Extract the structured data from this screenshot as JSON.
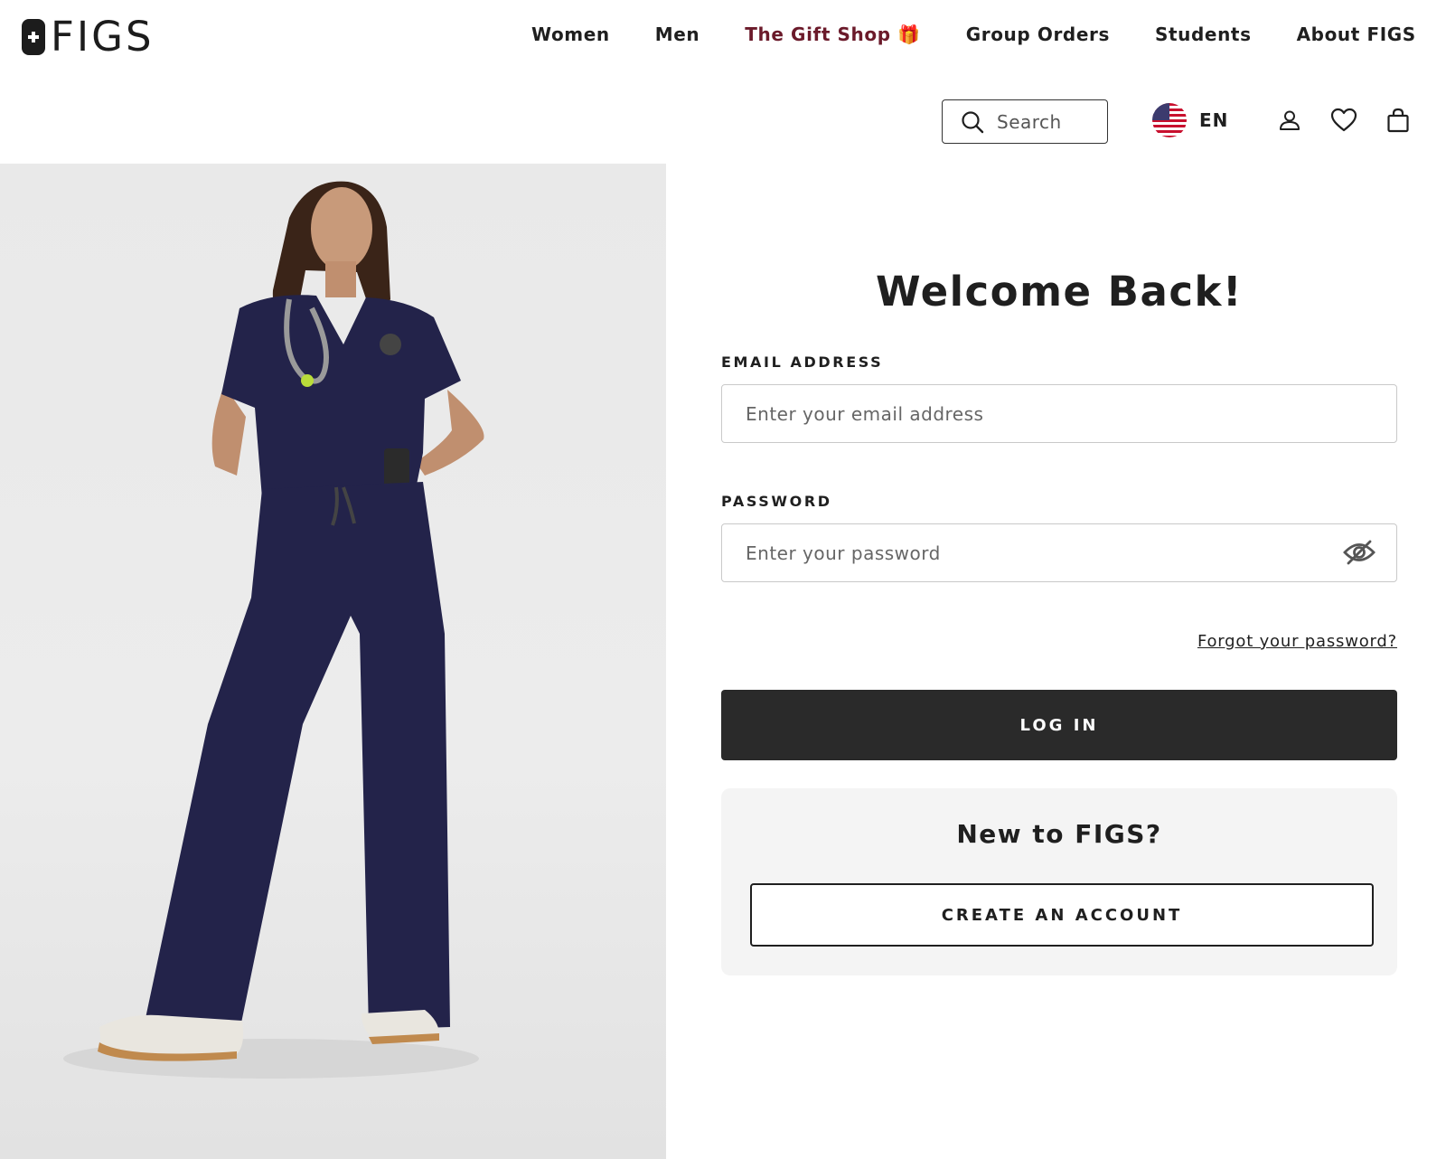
{
  "header": {
    "logo_text": "FIGS",
    "nav": [
      {
        "label": "Women"
      },
      {
        "label": "Men"
      },
      {
        "label": "The Gift Shop 🎁"
      },
      {
        "label": "Group Orders"
      },
      {
        "label": "Students"
      },
      {
        "label": "About FIGS"
      }
    ],
    "search_label": "Search",
    "language": "EN",
    "icons": [
      "search-icon",
      "us-flag-icon",
      "account-icon",
      "heart-icon",
      "bag-icon"
    ]
  },
  "login": {
    "title": "Welcome Back!",
    "email_label": "EMAIL ADDRESS",
    "email_placeholder": "Enter your email address",
    "email_value": "",
    "password_label": "PASSWORD",
    "password_placeholder": "Enter your password",
    "password_value": "",
    "forgot_link": "Forgot your password?",
    "login_button": "LOG IN"
  },
  "signup": {
    "title": "New to FIGS?",
    "create_button": "CREATE AN ACCOUNT"
  },
  "colors": {
    "accent_gift": "#6b1a2a",
    "button_dark": "#2a2a2a",
    "scrubs_navy": "#23234a"
  }
}
